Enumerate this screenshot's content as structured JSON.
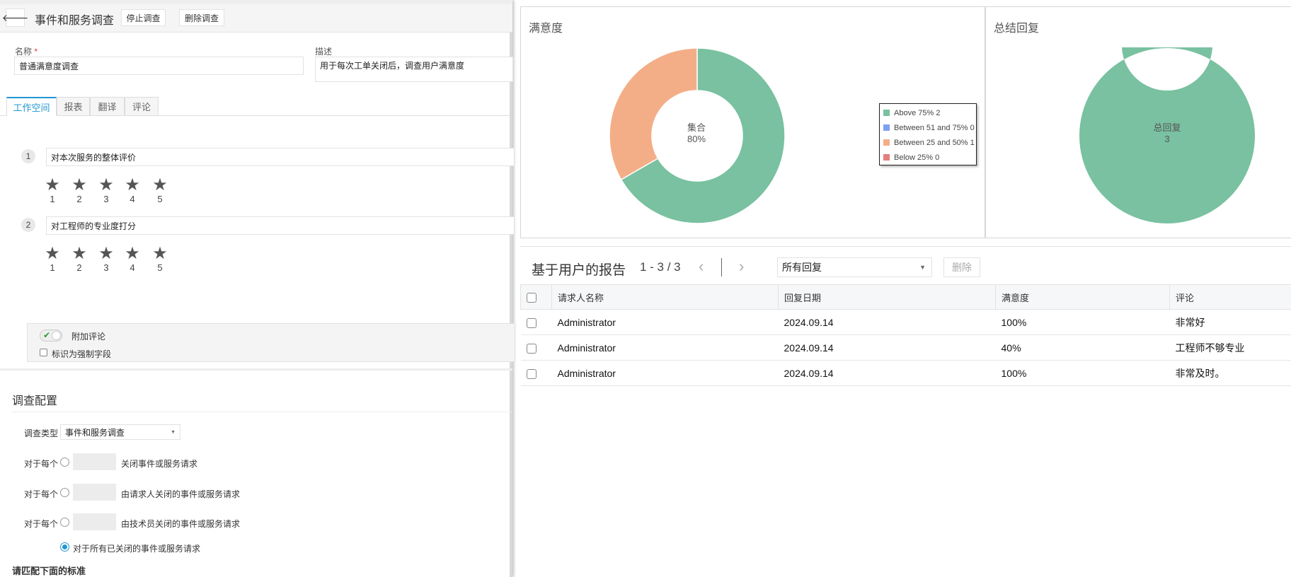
{
  "header": {
    "title": "事件和服务调查",
    "stop_label": "停止调查",
    "delete_label": "删除调查",
    "back_icon": "arrow-left-icon"
  },
  "form": {
    "name_label": "名称",
    "required_mark": "*",
    "name_value": "普通满意度调查",
    "desc_label": "描述",
    "desc_value": "用于每次工单关闭后，调查用户满意度"
  },
  "tabs": [
    {
      "label": "工作空间",
      "active": true
    },
    {
      "label": "报表"
    },
    {
      "label": "翻译"
    },
    {
      "label": "评论"
    }
  ],
  "questions": [
    {
      "num": "1",
      "text": "对本次服务的整体评价",
      "stars": [
        "1",
        "2",
        "3",
        "4",
        "5"
      ]
    },
    {
      "num": "2",
      "text": "对工程师的专业度打分",
      "stars": [
        "1",
        "2",
        "3",
        "4",
        "5"
      ]
    }
  ],
  "options": {
    "add_comment": "附加评论",
    "add_comment_on": true,
    "mandatory": "标识为强制字段",
    "mandatory_checked": false
  },
  "config": {
    "title": "调查配置",
    "type_label": "调查类型",
    "type_value": "事件和服务调查",
    "rows": [
      {
        "prefix": "对于每个",
        "suffix": "关闭事件或服务请求"
      },
      {
        "prefix": "对于每个",
        "suffix": "由请求人关闭的事件或服务请求"
      },
      {
        "prefix": "对于每个",
        "suffix": "由技术员关闭的事件或服务请求"
      }
    ],
    "all_label": "对于所有已关闭的事件或服务请求",
    "criteria_title": "请匹配下面的标准"
  },
  "chart_data": [
    {
      "type": "pie",
      "title": "满意度",
      "center_label": "集合",
      "center_value": "80%",
      "legend": [
        {
          "label": "Above 75% 2",
          "value": 2,
          "color": "#79c1a0"
        },
        {
          "label": "Between 51 and 75% 0",
          "value": 0,
          "color": "#7f9ff0"
        },
        {
          "label": "Between 25 and 50% 1",
          "value": 1,
          "color": "#f4ae87"
        },
        {
          "label": "Below 25% 0",
          "value": 0,
          "color": "#e57e7e"
        }
      ],
      "legend_position": "right"
    },
    {
      "type": "pie",
      "title": "总结回复",
      "center_label": "总回复",
      "center_value": "3",
      "values": [
        3
      ],
      "colors": [
        "#79c1a0"
      ]
    }
  ],
  "report": {
    "title": "基于用户的报告",
    "range": "1 - 3 / 3",
    "filter": "所有回复",
    "delete_label": "删除",
    "columns": [
      "请求人名称",
      "回复日期",
      "满意度",
      "评论"
    ],
    "rows": [
      [
        "Administrator",
        "2024.09.14",
        "100%",
        "非常好"
      ],
      [
        "Administrator",
        "2024.09.14",
        "40%",
        "工程师不够专业"
      ],
      [
        "Administrator",
        "2024.09.14",
        "100%",
        "非常及时。"
      ]
    ]
  }
}
